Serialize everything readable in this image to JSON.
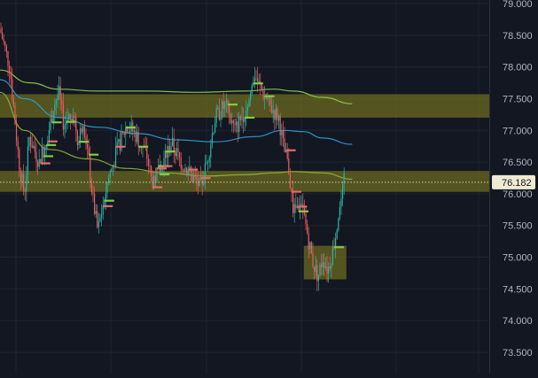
{
  "chart_data": {
    "type": "candlestick",
    "price_axis": {
      "ticks": [
        "79.000",
        "78.500",
        "78.000",
        "77.500",
        "77.000",
        "76.500",
        "76.000",
        "75.500",
        "75.000",
        "74.500",
        "74.000",
        "73.500"
      ],
      "ylim": [
        73.3,
        79.0
      ]
    },
    "last_price": {
      "label": "76.182",
      "value": 76.182
    },
    "zones": [
      {
        "from": 77.2,
        "to": 77.57,
        "color": "#7b7a1e"
      },
      {
        "from": 76.03,
        "to": 76.36,
        "color": "#7b7a1e"
      },
      {
        "from": 74.65,
        "to": 75.18,
        "color": "#7b7a1e",
        "x_range": [
          0.621,
          0.708
        ]
      }
    ],
    "moving_averages": [
      {
        "color": "#2f9fd8",
        "points": [
          [
            0.0,
            77.8
          ],
          [
            0.05,
            77.5
          ],
          [
            0.12,
            77.2
          ],
          [
            0.2,
            77.05
          ],
          [
            0.28,
            76.95
          ],
          [
            0.36,
            76.85
          ],
          [
            0.44,
            76.82
          ],
          [
            0.52,
            76.9
          ],
          [
            0.58,
            77.0
          ],
          [
            0.62,
            76.98
          ],
          [
            0.66,
            76.88
          ],
          [
            0.72,
            76.78
          ]
        ]
      },
      {
        "color": "#8fd14f",
        "points": [
          [
            0.0,
            77.95
          ],
          [
            0.06,
            77.75
          ],
          [
            0.12,
            77.65
          ],
          [
            0.2,
            77.62
          ],
          [
            0.3,
            77.62
          ],
          [
            0.4,
            77.6
          ],
          [
            0.5,
            77.62
          ],
          [
            0.56,
            77.65
          ],
          [
            0.6,
            77.62
          ],
          [
            0.66,
            77.52
          ],
          [
            0.72,
            77.42
          ]
        ]
      },
      {
        "color": "#8fb83a",
        "points": [
          [
            0.0,
            77.6
          ],
          [
            0.05,
            77.0
          ],
          [
            0.1,
            76.7
          ],
          [
            0.18,
            76.55
          ],
          [
            0.26,
            76.4
          ],
          [
            0.34,
            76.33
          ],
          [
            0.42,
            76.28
          ],
          [
            0.5,
            76.3
          ],
          [
            0.56,
            76.33
          ],
          [
            0.6,
            76.35
          ],
          [
            0.66,
            76.33
          ],
          [
            0.72,
            76.23
          ]
        ]
      }
    ],
    "price_path": [
      [
        0.0,
        78.6
      ],
      [
        0.02,
        78.0
      ],
      [
        0.03,
        77.2
      ],
      [
        0.04,
        76.4
      ],
      [
        0.05,
        76.0
      ],
      [
        0.06,
        76.9
      ],
      [
        0.08,
        76.5
      ],
      [
        0.1,
        77.0
      ],
      [
        0.11,
        77.4
      ],
      [
        0.12,
        77.6
      ],
      [
        0.13,
        77.1
      ],
      [
        0.15,
        77.3
      ],
      [
        0.16,
        76.8
      ],
      [
        0.17,
        77.2
      ],
      [
        0.18,
        76.6
      ],
      [
        0.19,
        75.9
      ],
      [
        0.2,
        75.4
      ],
      [
        0.21,
        75.8
      ],
      [
        0.22,
        76.2
      ],
      [
        0.24,
        76.7
      ],
      [
        0.26,
        77.1
      ],
      [
        0.28,
        76.9
      ],
      [
        0.3,
        76.6
      ],
      [
        0.31,
        76.2
      ],
      [
        0.33,
        76.4
      ],
      [
        0.35,
        76.8
      ],
      [
        0.37,
        76.5
      ],
      [
        0.39,
        76.3
      ],
      [
        0.41,
        76.1
      ],
      [
        0.42,
        76.4
      ],
      [
        0.44,
        77.2
      ],
      [
        0.46,
        77.4
      ],
      [
        0.48,
        77.0
      ],
      [
        0.5,
        77.3
      ],
      [
        0.51,
        77.5
      ],
      [
        0.52,
        77.9
      ],
      [
        0.53,
        77.7
      ],
      [
        0.55,
        77.4
      ],
      [
        0.57,
        77.2
      ],
      [
        0.58,
        76.7
      ],
      [
        0.59,
        76.4
      ],
      [
        0.6,
        75.7
      ],
      [
        0.61,
        75.8
      ],
      [
        0.62,
        75.7
      ],
      [
        0.63,
        75.3
      ],
      [
        0.64,
        74.9
      ],
      [
        0.65,
        74.7
      ],
      [
        0.66,
        75.0
      ],
      [
        0.67,
        74.8
      ],
      [
        0.68,
        75.1
      ],
      [
        0.69,
        75.6
      ],
      [
        0.7,
        76.0
      ],
      [
        0.705,
        76.3
      ]
    ],
    "grid": true
  }
}
